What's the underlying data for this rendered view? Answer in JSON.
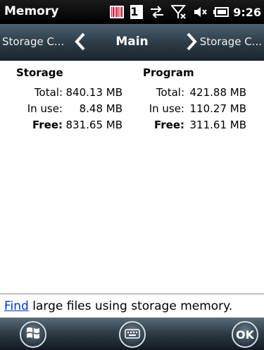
{
  "titlebar": {
    "title": "Memory",
    "clock": "9:26",
    "badge_number": "1",
    "icons": [
      "barcode-icon",
      "number-badge-icon",
      "sync-arrows-icon",
      "signal-off-icon",
      "volume-mute-icon",
      "battery-icon"
    ]
  },
  "tabs": {
    "left": "Storage C...",
    "center": "Main",
    "right": "Storage C..."
  },
  "storage": {
    "heading": "Storage",
    "total_label": "Total:",
    "total_value": "840.13 MB",
    "inuse_label": "In use:",
    "inuse_value": "8.48 MB",
    "free_label": "Free:",
    "free_value": "831.65 MB"
  },
  "program": {
    "heading": "Program",
    "total_label": "Total:",
    "total_value": "421.88 MB",
    "inuse_label": "In use:",
    "inuse_value": "110.27 MB",
    "free_label": "Free:",
    "free_value": "311.61 MB"
  },
  "footer": {
    "link_text": "Find",
    "rest_text": " large files using storage memory."
  },
  "softkeys": {
    "ok_label": "OK"
  },
  "colors": {
    "link": "#0033cc",
    "tabbar": "#2e3d49",
    "titlebar": "#000000"
  }
}
